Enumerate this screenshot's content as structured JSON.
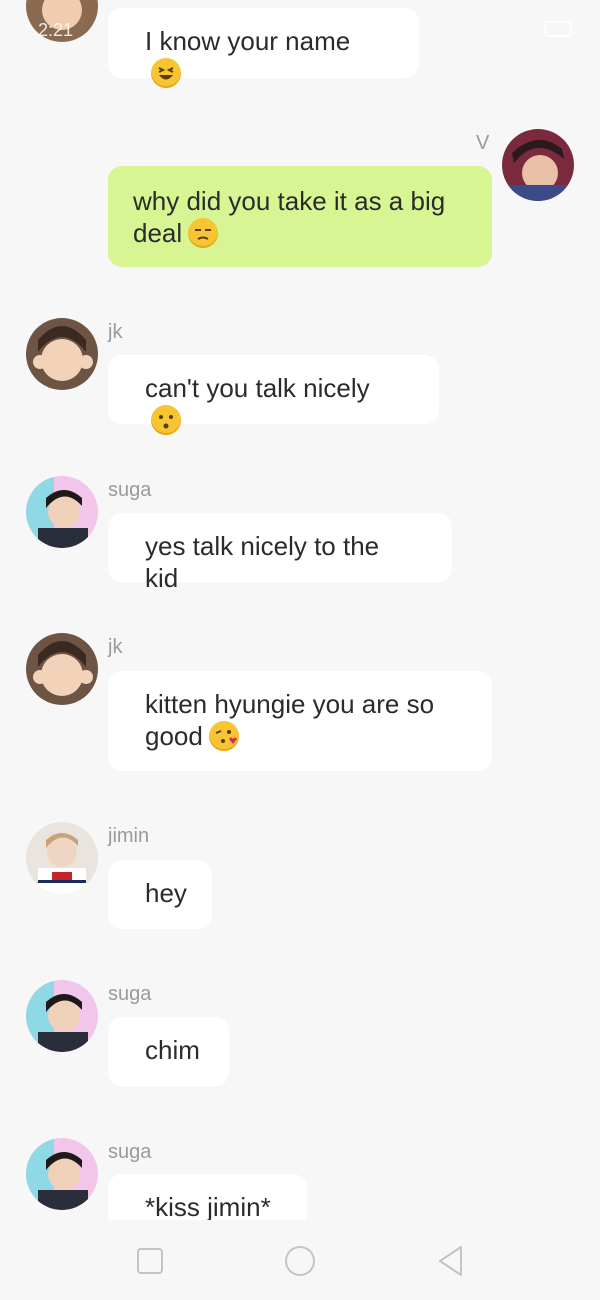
{
  "status_bar": {
    "time": "2:21"
  },
  "messages": [
    {
      "sender": "",
      "text": "I know your name",
      "emoji": "grinning-squint-emoji",
      "avatar": "jk-avatar"
    },
    {
      "sender": "V",
      "text": "why did you take it as a big deal",
      "emoji": "unamused-emoji",
      "avatar": "v-avatar",
      "mine": true
    },
    {
      "sender": "jk",
      "text": "can't you talk nicely",
      "emoji": "kissing-emoji",
      "avatar": "jk-avatar"
    },
    {
      "sender": "suga",
      "text": "yes talk nicely to the kid",
      "avatar": "suga-avatar"
    },
    {
      "sender": "jk",
      "text": "kitten hyungie you are so good",
      "emoji": "kissing-heart-emoji",
      "avatar": "jk-avatar"
    },
    {
      "sender": "jimin",
      "text": "hey",
      "avatar": "jimin-avatar"
    },
    {
      "sender": "suga",
      "text": "chim",
      "avatar": "suga-avatar"
    },
    {
      "sender": "suga",
      "text": "*kiss jimin*",
      "avatar": "suga-avatar"
    }
  ],
  "nav_bar": {
    "buttons": [
      "recent-apps-icon",
      "home-icon",
      "back-icon"
    ]
  },
  "colors": {
    "background": "#f7f7f7",
    "bubble": "#ffffff",
    "my_bubble": "#d8f594",
    "sender_text": "#9a9a9a",
    "emoji": "#f7c531"
  }
}
